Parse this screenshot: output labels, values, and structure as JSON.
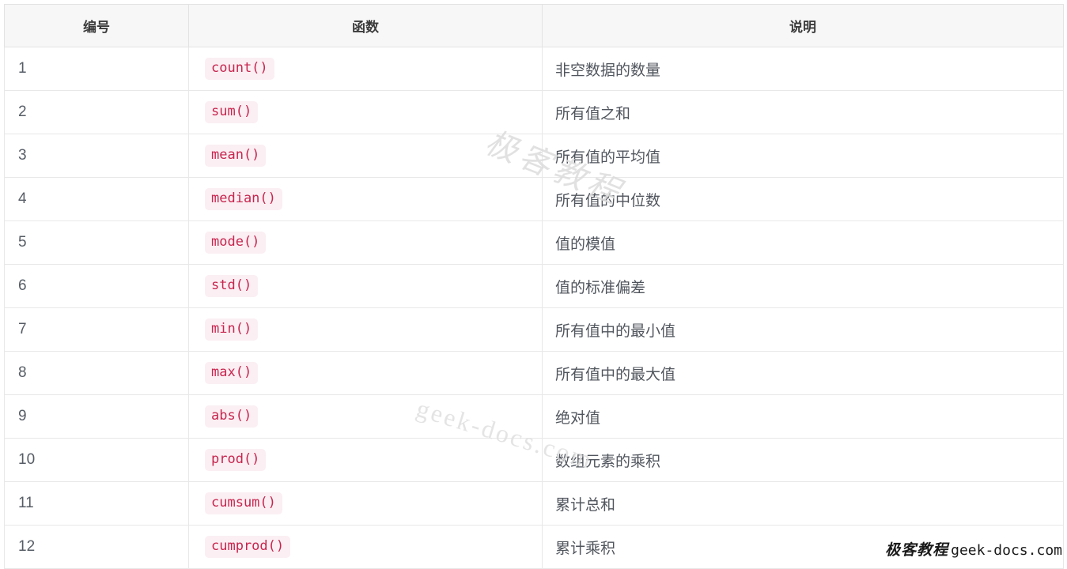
{
  "table": {
    "headers": [
      "编号",
      "函数",
      "说明"
    ],
    "rows": [
      {
        "num": "1",
        "fn": "count()",
        "desc": "非空数据的数量"
      },
      {
        "num": "2",
        "fn": "sum()",
        "desc": "所有值之和"
      },
      {
        "num": "3",
        "fn": "mean()",
        "desc": "所有值的平均值"
      },
      {
        "num": "4",
        "fn": "median()",
        "desc": "所有值的中位数"
      },
      {
        "num": "5",
        "fn": "mode()",
        "desc": "值的模值"
      },
      {
        "num": "6",
        "fn": "std()",
        "desc": "值的标准偏差"
      },
      {
        "num": "7",
        "fn": "min()",
        "desc": "所有值中的最小值"
      },
      {
        "num": "8",
        "fn": "max()",
        "desc": "所有值中的最大值"
      },
      {
        "num": "9",
        "fn": "abs()",
        "desc": "绝对值"
      },
      {
        "num": "10",
        "fn": "prod()",
        "desc": "数组元素的乘积"
      },
      {
        "num": "11",
        "fn": "cumsum()",
        "desc": "累计总和"
      },
      {
        "num": "12",
        "fn": "cumprod()",
        "desc": "累计乘积"
      }
    ]
  },
  "watermarks": {
    "chinese": "极客教程",
    "english": "geek-docs.com"
  },
  "brand": {
    "cn": "极客教程",
    "en": "geek-docs.com"
  },
  "colors": {
    "code_text": "#c7254e",
    "code_background": "#fbeff3",
    "header_background": "#f7f7f7",
    "border": "#e8e8e8",
    "body_text": "#51565e",
    "watermark": "#dcdcdc"
  }
}
